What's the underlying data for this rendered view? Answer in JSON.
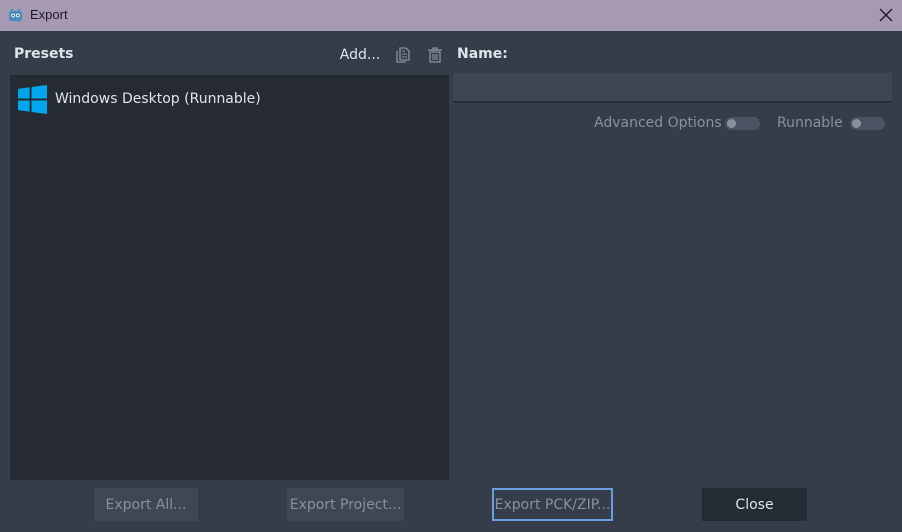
{
  "window": {
    "title": "Export",
    "close_icon": "close-icon",
    "app_icon": "godot-icon"
  },
  "presets": {
    "label": "Presets",
    "add_label": "Add...",
    "duplicate_icon": "duplicate-icon",
    "delete_icon": "trash-icon",
    "items": [
      {
        "label": "Windows Desktop (Runnable)",
        "icon": "windows-icon"
      }
    ]
  },
  "details": {
    "name_label": "Name:",
    "name_value": "",
    "advanced_options_label": "Advanced Options",
    "advanced_options_on": false,
    "runnable_label": "Runnable",
    "runnable_on": false
  },
  "buttons": {
    "export_all": "Export All...",
    "export_project": "Export Project...",
    "export_pck": "Export PCK/ZIP...",
    "close": "Close"
  },
  "colors": {
    "title_bar": "#a69ab2",
    "panel_bg": "#363d4a",
    "list_bg": "#262b33",
    "windows_blue": "#00a6ed",
    "focus_border": "#6a9de0"
  }
}
